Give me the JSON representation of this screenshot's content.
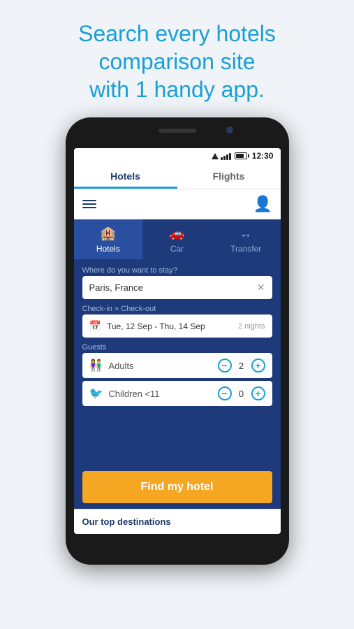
{
  "headline": {
    "line1": "Search every hotels",
    "line2": "comparison site",
    "line3": "with 1 handy app."
  },
  "status_bar": {
    "time": "12:30"
  },
  "tabs": {
    "hotels": "Hotels",
    "flights": "Flights"
  },
  "category_tabs": [
    {
      "id": "hotels",
      "label": "Hotels",
      "icon": "🏨",
      "active": true
    },
    {
      "id": "car",
      "label": "Car",
      "icon": "🚗",
      "active": false
    },
    {
      "id": "transfer",
      "label": "Transfer",
      "icon": "🔄",
      "active": false
    }
  ],
  "form": {
    "destination_label": "Where do you want to stay?",
    "destination_value": "Paris, France",
    "checkin_label": "Check-in » Check-out",
    "checkin_value": "Tue, 12 Sep - Thu, 14 Sep",
    "nights_value": "2 nights",
    "guests_label": "Guests",
    "adults_label": "Adults",
    "adults_count": "2",
    "children_label": "Children <11",
    "children_count": "0"
  },
  "find_button": {
    "label": "Find my hotel"
  },
  "destinations": {
    "label": "Our top destinations"
  }
}
